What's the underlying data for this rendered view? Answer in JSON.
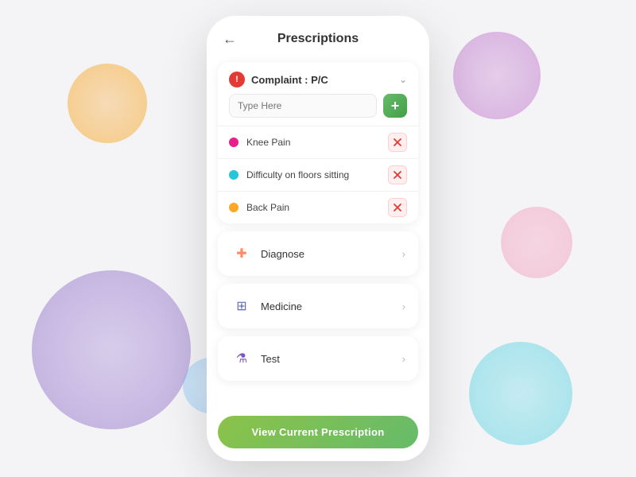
{
  "background": {
    "blobs": [
      "orange",
      "purple-large",
      "purple-top",
      "pink",
      "teal",
      "blue-small"
    ]
  },
  "header": {
    "back_label": "←",
    "title": "Prescriptions"
  },
  "complaint": {
    "icon_text": "!",
    "label": "Complaint : P/C",
    "input_placeholder": "Type Here",
    "add_btn_label": "+",
    "items": [
      {
        "text": "Knee Pain",
        "dot_class": "dot-pink"
      },
      {
        "text": "Difficulty on floors sitting",
        "dot_class": "dot-teal"
      },
      {
        "text": "Back Pain",
        "dot_class": "dot-orange"
      }
    ]
  },
  "sections": [
    {
      "label": "Diagnose",
      "icon": "✚",
      "icon_class": "diagnose-icon"
    },
    {
      "label": "Medicine",
      "icon": "⊞",
      "icon_class": "medicine-icon"
    },
    {
      "label": "Test",
      "icon": "⚗",
      "icon_class": "test-icon"
    }
  ],
  "view_btn_label": "View Current Prescription"
}
